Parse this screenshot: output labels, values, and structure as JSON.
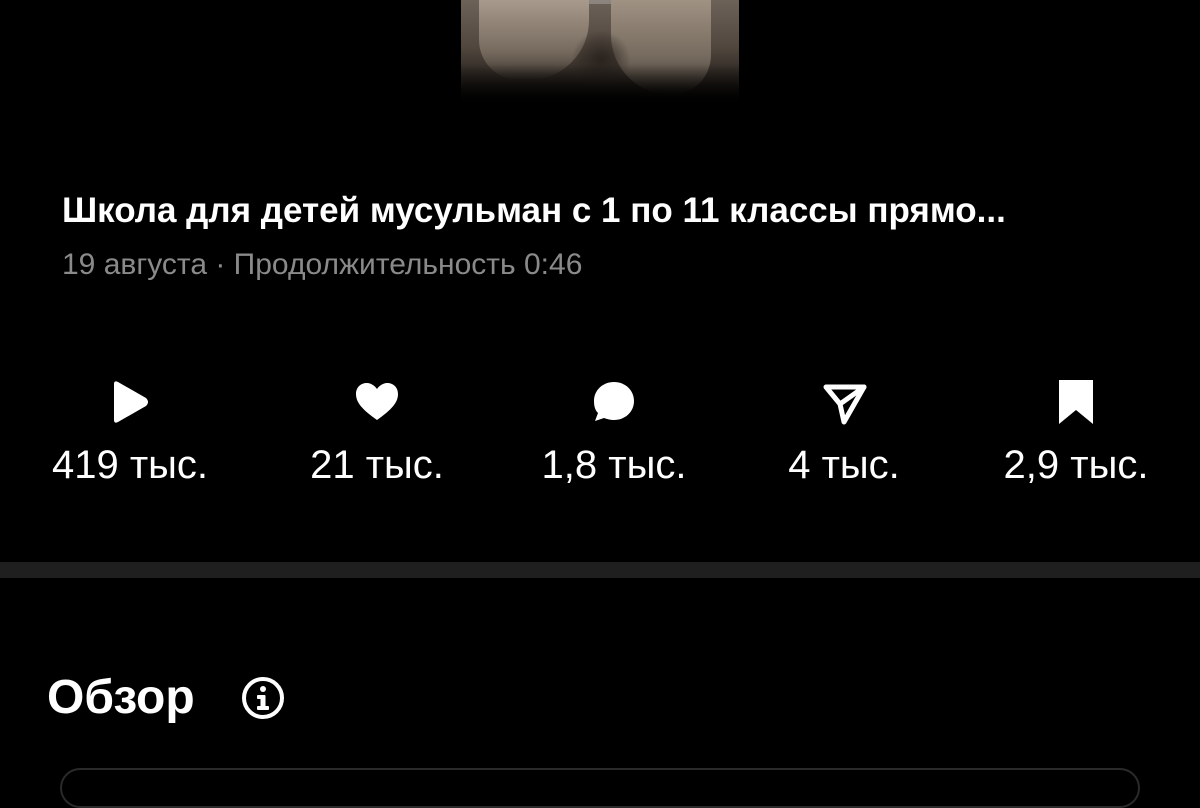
{
  "video": {
    "title": "Школа для детей мусульман с 1 по 11 классы прямо...",
    "meta": "19 августа · Продолжительность 0:46"
  },
  "stats": {
    "plays": {
      "icon": "play-icon",
      "value": "419 тыс."
    },
    "likes": {
      "icon": "heart-icon",
      "value": "21 тыс."
    },
    "comments": {
      "icon": "comment-bubble-icon",
      "value": "1,8 тыс."
    },
    "shares": {
      "icon": "send-arrow-icon",
      "value": "4 тыс."
    },
    "saves": {
      "icon": "bookmark-icon",
      "value": "2,9 тыс."
    }
  },
  "overview": {
    "title": "Обзор",
    "icon": "info-icon"
  },
  "colors": {
    "background": "#000000",
    "text_primary": "#ffffff",
    "text_secondary": "#8a8a8a",
    "divider": "#1f1f1f"
  }
}
